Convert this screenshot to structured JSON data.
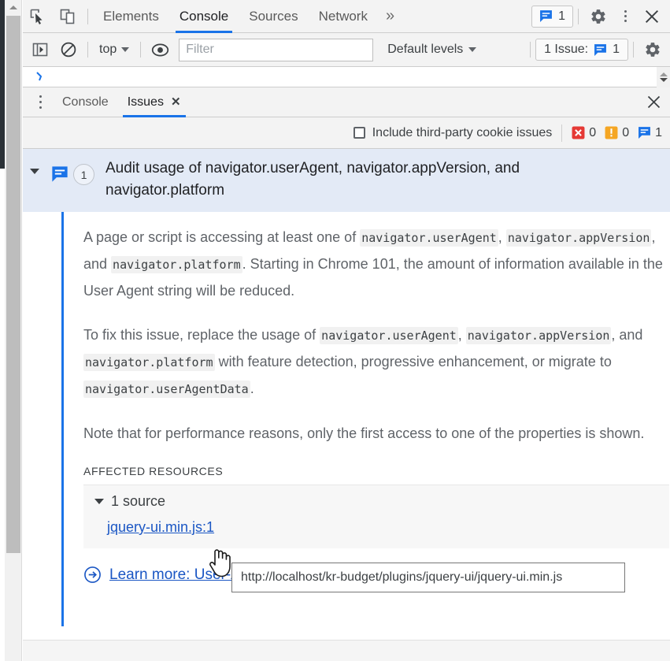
{
  "window": {
    "scrollbar": "vertical-scrollbar"
  },
  "tabbar": {
    "inspect_icon": "inspect-element-icon",
    "device_icon": "device-toolbar-icon",
    "tabs": [
      {
        "label": "Elements",
        "active": false
      },
      {
        "label": "Console",
        "active": true
      },
      {
        "label": "Sources",
        "active": false
      },
      {
        "label": "Network",
        "active": false
      }
    ],
    "more_tabs": "»",
    "issue_badge_count": "1",
    "settings_icon": "gear-icon",
    "menu_icon": "kebab-menu-icon",
    "close_icon": "close-icon"
  },
  "console_toolbar": {
    "sidebar_icon": "show-console-sidebar-icon",
    "clear_icon": "clear-console-icon",
    "context": "top",
    "eye_icon": "live-expression-icon",
    "filter_placeholder": "Filter",
    "filter_value": "",
    "levels": "Default levels",
    "issues_button": "1 Issue:",
    "issues_count": "1",
    "settings_icon": "gear-icon"
  },
  "drawer": {
    "menu_icon": "kebab-menu-icon",
    "tabs": [
      {
        "label": "Console",
        "active": false,
        "closable": false
      },
      {
        "label": "Issues",
        "active": true,
        "closable": true,
        "close_glyph": "✕"
      }
    ],
    "close_icon": "close-drawer-icon"
  },
  "issues_filter": {
    "checkbox_label": "Include third-party cookie issues",
    "checked": false,
    "error_count": "0",
    "warning_count": "0",
    "info_count": "1"
  },
  "issue": {
    "expanded": true,
    "badge_count": "1",
    "title": "Audit usage of navigator.userAgent, navigator.appVersion, and navigator.platform",
    "paragraphs": [
      [
        {
          "t": "text",
          "v": "A page or script is accessing at least one of "
        },
        {
          "t": "code",
          "v": "navigator.userAgent"
        },
        {
          "t": "text",
          "v": ", "
        },
        {
          "t": "code",
          "v": "navigator.appVersion"
        },
        {
          "t": "text",
          "v": ", and "
        },
        {
          "t": "code",
          "v": "navigator.platform"
        },
        {
          "t": "text",
          "v": ". Starting in Chrome 101, the amount of information available in the User Agent string will be reduced."
        }
      ],
      [
        {
          "t": "text",
          "v": "To fix this issue, replace the usage of "
        },
        {
          "t": "code",
          "v": "navigator.userAgent"
        },
        {
          "t": "text",
          "v": ", "
        },
        {
          "t": "code",
          "v": "navigator.appVersion"
        },
        {
          "t": "text",
          "v": ", and "
        },
        {
          "t": "code",
          "v": "navigator.platform"
        },
        {
          "t": "text",
          "v": " with feature detection, progressive enhancement, or migrate to "
        },
        {
          "t": "code",
          "v": "navigator.userAgentData"
        },
        {
          "t": "text",
          "v": "."
        }
      ],
      [
        {
          "t": "text",
          "v": "Note that for performance reasons, only the first access to one of the properties is shown."
        }
      ]
    ],
    "affected_resources_label": "AFFECTED RESOURCES",
    "sources_toggle": "1 source",
    "source_link": "jquery-ui.min.js:1",
    "learn_more": "Learn more: User-Agent String Reduction",
    "learn_more_icon": "external-link-arrow-icon"
  },
  "tooltip": {
    "text": "http://localhost/kr-budget/plugins/jquery-ui/jquery-ui.min.js"
  },
  "colors": {
    "accent_blue": "#1a73e8",
    "link_blue": "#1a56c4",
    "issue_header_bg": "#e3eaf6",
    "error_red": "#e53935",
    "warning_orange": "#f5a623",
    "info_blue": "#1a73e8"
  }
}
